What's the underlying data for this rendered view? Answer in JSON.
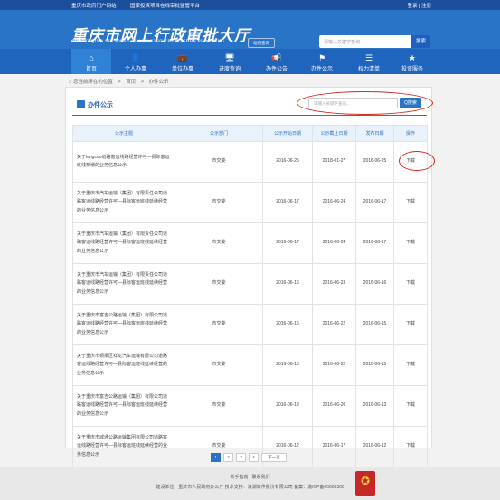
{
  "topbar": {
    "link_gov": "重庆市政府门户网站",
    "link_platform": "国家投资项目在线审批监管平台",
    "login": "登录",
    "divider": "|",
    "register": "注册"
  },
  "header": {
    "logo_cn": "重庆市网上行政审批大厅",
    "logo_en": "CHONG QING SHI WANG SHANG XING ZHENG SHEN PI DA TING",
    "site_btn": "站内查询",
    "search_placeholder": "请输入关键字查询",
    "search_btn": "搜索"
  },
  "nav": [
    {
      "label": "首页",
      "icon": "home-icon",
      "glyph": "⌂"
    },
    {
      "label": "个人办事",
      "icon": "person-icon",
      "glyph": "👤"
    },
    {
      "label": "单位办事",
      "icon": "briefcase-icon",
      "glyph": "💼"
    },
    {
      "label": "进度查询",
      "icon": "monitor-icon",
      "glyph": "🖥"
    },
    {
      "label": "办件公告",
      "icon": "announce-icon",
      "glyph": "📢"
    },
    {
      "label": "办件公示",
      "icon": "flag-icon",
      "glyph": "⚑"
    },
    {
      "label": "权力清单",
      "icon": "list-icon",
      "glyph": "☰"
    },
    {
      "label": "投资服务",
      "icon": "star-icon",
      "glyph": "★"
    }
  ],
  "breadcrumb": {
    "prefix": "您当前所在的位置",
    "home": "首页",
    "sep": ">",
    "current": "办件公示"
  },
  "panel": {
    "title": "办件公示",
    "search_placeholder": "请输入关键字查询...",
    "search_btn": "Q搜索"
  },
  "table": {
    "headers": [
      "公示主题",
      "公示部门",
      "公示开始日期",
      "公示截止日期",
      "发布日期",
      "操作"
    ],
    "rows": [
      {
        "topic": "关于langcao道路客运线路经营许可—县际客运班线新增的业务信息公示",
        "dept": "市交委",
        "start": "2016-06-25",
        "end": "2018-01-27",
        "pub": "2016-06-25",
        "action": "下载"
      },
      {
        "topic": "关于重庆市汽车运输（集团）有限责任公司道路客运线路经营许可—县际客运班线延续经营的业务信息公示",
        "dept": "市交委",
        "start": "2016-06-17",
        "end": "2016-06-24",
        "pub": "2016-06-17",
        "action": "下载"
      },
      {
        "topic": "关于重庆市汽车运输（集团）有限责任公司道路客运线路经营许可—县际客运班线延续经营的业务信息公示",
        "dept": "市交委",
        "start": "2016-06-17",
        "end": "2016-06-24",
        "pub": "2016-06-17",
        "action": "下载"
      },
      {
        "topic": "关于重庆市汽车运输（集团）有限责任公司道路客运线路经营许可—县际客运班线延续经营的业务信息公示",
        "dept": "市交委",
        "start": "2016-06-16",
        "end": "2016-06-23",
        "pub": "2016-06-16",
        "action": "下载"
      },
      {
        "topic": "关于重庆市富吉公路运输（集团）有限公司道路客运线路经营许可—县际客运班线延续经营的业务信息公示",
        "dept": "市交委",
        "start": "2016-06-15",
        "end": "2016-06-22",
        "pub": "2016-06-15",
        "action": "下载"
      },
      {
        "topic": "关于重庆市铜梁区祥龙汽车运输有限公司道路客运线路经营许可—县际客运班线延续经营的业务信息公示",
        "dept": "市交委",
        "start": "2016-06-15",
        "end": "2016-06-22",
        "pub": "2016-06-15",
        "action": "下载"
      },
      {
        "topic": "关于重庆市富吉公路运输（集团）有限公司道路客运线路经营许可—县际客运班线延续经营的业务信息公示",
        "dept": "市交委",
        "start": "2016-06-13",
        "end": "2016-06-20",
        "pub": "2016-06-13",
        "action": "下载"
      },
      {
        "topic": "关于重庆市城通公路运输集团有限公司道路客运线路经营许可—县际客运班线延续经营的业务信息公示",
        "dept": "市交委",
        "start": "2016-06-12",
        "end": "2016-06-17",
        "pub": "2016-06-12",
        "action": "下载"
      }
    ]
  },
  "pager": [
    "1",
    "2",
    "3",
    "4",
    "下一页"
  ],
  "footer": {
    "links": "新手指南 | 联系我们",
    "info": "建设单位：重庆市人民政府办公厅    技术支持：浪潮软件股份有限公司    备案：渝ICP备05003300",
    "badge": "党政机关"
  },
  "colors": {
    "primary": "#2a74c8",
    "nav": "#1f64bd",
    "topbar": "#1b4e9b",
    "highlight": "#d4251d"
  }
}
